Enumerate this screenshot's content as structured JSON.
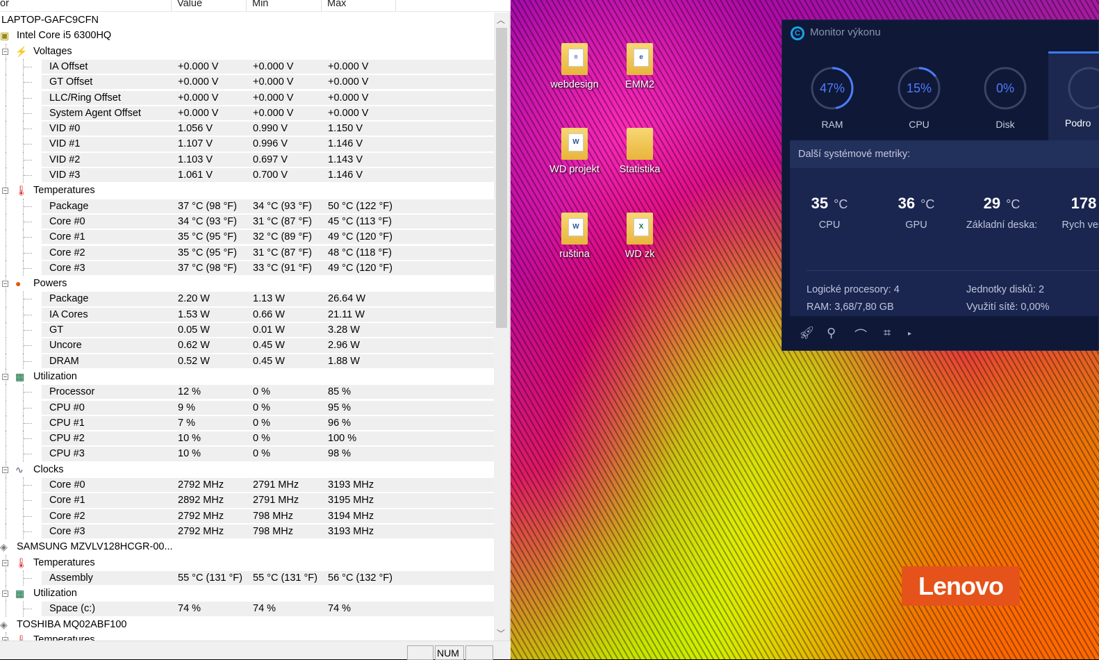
{
  "hwinfo": {
    "columns": {
      "sensor": "or",
      "value": "Value",
      "min": "Min",
      "max": "Max"
    },
    "status": {
      "num": "NUM"
    },
    "rows": [
      {
        "level": 0,
        "kind": "root",
        "name": "LAPTOP-GAFC9CFN"
      },
      {
        "level": 1,
        "kind": "cpu",
        "name": "Intel Core i5 6300HQ"
      },
      {
        "level": 2,
        "kind": "voltage",
        "name": "Voltages"
      },
      {
        "level": 3,
        "name": "IA Offset",
        "value": "+0.000 V",
        "min": "+0.000 V",
        "max": "+0.000 V"
      },
      {
        "level": 3,
        "name": "GT Offset",
        "value": "+0.000 V",
        "min": "+0.000 V",
        "max": "+0.000 V"
      },
      {
        "level": 3,
        "name": "LLC/Ring Offset",
        "value": "+0.000 V",
        "min": "+0.000 V",
        "max": "+0.000 V"
      },
      {
        "level": 3,
        "name": "System Agent Offset",
        "value": "+0.000 V",
        "min": "+0.000 V",
        "max": "+0.000 V"
      },
      {
        "level": 3,
        "name": "VID #0",
        "value": "1.056 V",
        "min": "0.990 V",
        "max": "1.150 V"
      },
      {
        "level": 3,
        "name": "VID #1",
        "value": "1.107 V",
        "min": "0.996 V",
        "max": "1.146 V"
      },
      {
        "level": 3,
        "name": "VID #2",
        "value": "1.103 V",
        "min": "0.697 V",
        "max": "1.143 V"
      },
      {
        "level": 3,
        "name": "VID #3",
        "value": "1.061 V",
        "min": "0.700 V",
        "max": "1.146 V"
      },
      {
        "level": 2,
        "kind": "temp",
        "name": "Temperatures"
      },
      {
        "level": 3,
        "name": "Package",
        "value": "37 °C  (98 °F)",
        "min": "34 °C  (93 °F)",
        "max": "50 °C  (122 °F)"
      },
      {
        "level": 3,
        "name": "Core #0",
        "value": "34 °C  (93 °F)",
        "min": "31 °C  (87 °F)",
        "max": "45 °C  (113 °F)"
      },
      {
        "level": 3,
        "name": "Core #1",
        "value": "35 °C  (95 °F)",
        "min": "32 °C  (89 °F)",
        "max": "49 °C  (120 °F)"
      },
      {
        "level": 3,
        "name": "Core #2",
        "value": "35 °C  (95 °F)",
        "min": "31 °C  (87 °F)",
        "max": "48 °C  (118 °F)"
      },
      {
        "level": 3,
        "name": "Core #3",
        "value": "37 °C  (98 °F)",
        "min": "33 °C  (91 °F)",
        "max": "49 °C  (120 °F)"
      },
      {
        "level": 2,
        "kind": "power",
        "name": "Powers"
      },
      {
        "level": 3,
        "name": "Package",
        "value": "2.20 W",
        "min": "1.13 W",
        "max": "26.64 W"
      },
      {
        "level": 3,
        "name": "IA Cores",
        "value": "1.53 W",
        "min": "0.66 W",
        "max": "21.11 W"
      },
      {
        "level": 3,
        "name": "GT",
        "value": "0.05 W",
        "min": "0.01 W",
        "max": "3.28 W"
      },
      {
        "level": 3,
        "name": "Uncore",
        "value": "0.62 W",
        "min": "0.45 W",
        "max": "2.96 W"
      },
      {
        "level": 3,
        "name": "DRAM",
        "value": "0.52 W",
        "min": "0.45 W",
        "max": "1.88 W"
      },
      {
        "level": 2,
        "kind": "util",
        "name": "Utilization"
      },
      {
        "level": 3,
        "name": "Processor",
        "value": "12 %",
        "min": "0 %",
        "max": "85 %"
      },
      {
        "level": 3,
        "name": "CPU #0",
        "value": "9 %",
        "min": "0 %",
        "max": "95 %"
      },
      {
        "level": 3,
        "name": "CPU #1",
        "value": "7 %",
        "min": "0 %",
        "max": "96 %"
      },
      {
        "level": 3,
        "name": "CPU #2",
        "value": "10 %",
        "min": "0 %",
        "max": "100 %"
      },
      {
        "level": 3,
        "name": "CPU #3",
        "value": "10 %",
        "min": "0 %",
        "max": "98 %"
      },
      {
        "level": 2,
        "kind": "clock",
        "name": "Clocks"
      },
      {
        "level": 3,
        "name": "Core #0",
        "value": "2792 MHz",
        "min": "2791 MHz",
        "max": "3193 MHz"
      },
      {
        "level": 3,
        "name": "Core #1",
        "value": "2892 MHz",
        "min": "2791 MHz",
        "max": "3195 MHz"
      },
      {
        "level": 3,
        "name": "Core #2",
        "value": "2792 MHz",
        "min": "798 MHz",
        "max": "3194 MHz"
      },
      {
        "level": 3,
        "name": "Core #3",
        "value": "2792 MHz",
        "min": "798 MHz",
        "max": "3193 MHz"
      },
      {
        "level": 1,
        "kind": "disk",
        "name": "SAMSUNG MZVLV128HCGR-00..."
      },
      {
        "level": 2,
        "kind": "temp",
        "name": "Temperatures"
      },
      {
        "level": 3,
        "name": "Assembly",
        "value": "55 °C  (131 °F)",
        "min": "55 °C  (131 °F)",
        "max": "56 °C  (132 °F)"
      },
      {
        "level": 2,
        "kind": "util",
        "name": "Utilization"
      },
      {
        "level": 3,
        "name": "Space (c:)",
        "value": "74 %",
        "min": "74 %",
        "max": "74 %"
      },
      {
        "level": 1,
        "kind": "disk",
        "name": "TOSHIBA MQ02ABF100"
      },
      {
        "level": 2,
        "kind": "temp",
        "name": "Temperatures"
      }
    ]
  },
  "desktop": {
    "icons": [
      {
        "label": "webdesign",
        "type": "folder-doc"
      },
      {
        "label": "EMM2",
        "type": "pdf"
      },
      {
        "label": "WD projekt",
        "type": "word"
      },
      {
        "label": "Statistika",
        "type": "folder"
      },
      {
        "label": "ruština",
        "type": "word"
      },
      {
        "label": "WD zk",
        "type": "excel"
      }
    ],
    "brand": "Lenovo"
  },
  "monitor": {
    "title": "Monitor výkonu",
    "gauges": [
      {
        "label": "RAM",
        "value": "47%",
        "fraction": 0.47
      },
      {
        "label": "CPU",
        "value": "15%",
        "fraction": 0.15
      },
      {
        "label": "Disk",
        "value": "0%",
        "fraction": 0
      }
    ],
    "details_tab": "Podro",
    "metrics_header": "Další systémové metriky:",
    "temps": [
      {
        "value": "35",
        "unit": "°C",
        "label": "CPU"
      },
      {
        "value": "36",
        "unit": "°C",
        "label": "GPU"
      },
      {
        "value": "29",
        "unit": "°C",
        "label": "Základní deska:"
      },
      {
        "value": "178",
        "unit": "",
        "label": "Rych ventil"
      }
    ],
    "info": {
      "logical": "Logické procesory: 4",
      "ram": "RAM: 3,68/7,80 GB",
      "disks": "Jednotky disků: 2",
      "net": "Využití sítě: 0,00%"
    },
    "accent": "#4e7cff"
  }
}
